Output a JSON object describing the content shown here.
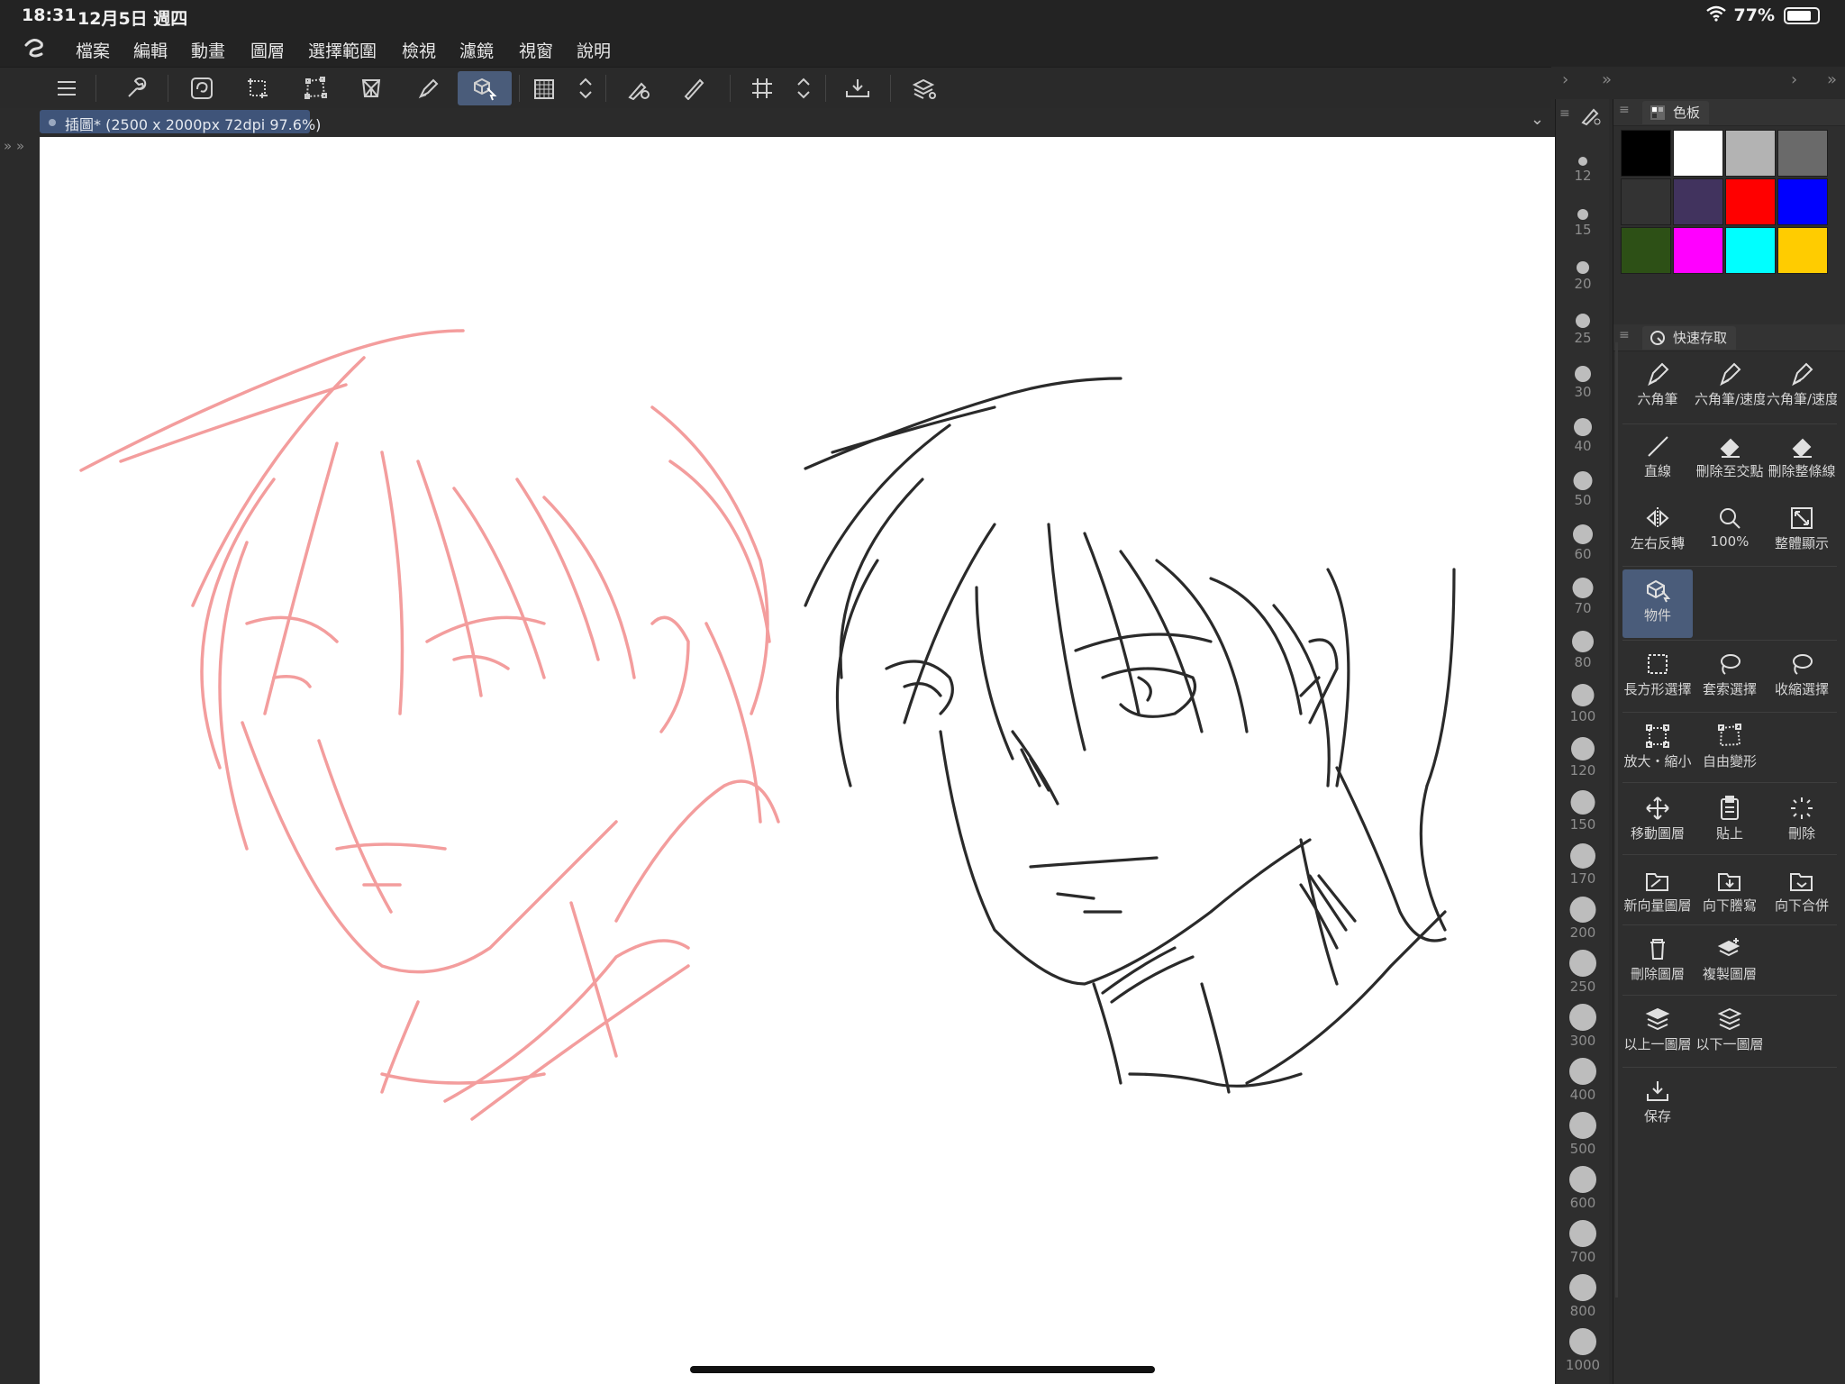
{
  "status_bar": {
    "time": "18:31",
    "date": "12月5日 週四",
    "battery_percent": "77%",
    "battery_level": 0.77,
    "wifi_icon": "wifi-icon"
  },
  "menu": [
    "檔案",
    "編輯",
    "動畫",
    "圖層",
    "選擇範圍",
    "檢視",
    "濾鏡",
    "視窗",
    "說明"
  ],
  "document": {
    "tab_label": "插圖* (2500 x 2000px 72dpi 97.6%)"
  },
  "brush_sizes": [
    "12",
    "15",
    "20",
    "25",
    "30",
    "40",
    "50",
    "60",
    "70",
    "80",
    "100",
    "120",
    "150",
    "170",
    "200",
    "250",
    "300",
    "400",
    "500",
    "600",
    "700",
    "800",
    "1000"
  ],
  "color_panel": {
    "title": "色板",
    "swatches": [
      "#000000",
      "#ffffff",
      "#b3b3b3",
      "#6a6a6a",
      "#333333",
      "#41335e",
      "#ff0000",
      "#0000ff",
      "#2d5016",
      "#ff00ff",
      "#00ffff",
      "#ffcc00"
    ]
  },
  "quick_access": {
    "title": "快速存取",
    "items": [
      {
        "label": "六角筆",
        "icon": "pen-nib-icon"
      },
      {
        "label": "六角筆/速度",
        "icon": "pen-nib-icon"
      },
      {
        "label": "六角筆/速度",
        "icon": "pen-nib-icon"
      },
      {
        "label": "直線",
        "icon": "line-icon"
      },
      {
        "label": "刪除至交點",
        "icon": "eraser-icon"
      },
      {
        "label": "刪除整條線",
        "icon": "eraser-icon"
      },
      {
        "label": "左右反轉",
        "icon": "flip-horizontal-icon"
      },
      {
        "label": "100%",
        "icon": "zoom-icon"
      },
      {
        "label": "整體顯示",
        "icon": "fit-screen-icon"
      },
      {
        "label": "物件",
        "icon": "object-select-icon"
      },
      {
        "label": "長方形選擇",
        "icon": "rect-select-icon"
      },
      {
        "label": "套索選擇",
        "icon": "lasso-icon"
      },
      {
        "label": "收縮選擇",
        "icon": "shrink-select-icon"
      },
      {
        "label": "放大・縮小",
        "icon": "scale-icon"
      },
      {
        "label": "自由變形",
        "icon": "free-transform-icon"
      },
      {
        "label": "移動圖層",
        "icon": "move-layer-icon"
      },
      {
        "label": "貼上",
        "icon": "paste-icon"
      },
      {
        "label": "刪除",
        "icon": "delete-selection-icon"
      },
      {
        "label": "新向量圖層",
        "icon": "new-vector-layer-icon"
      },
      {
        "label": "向下謄寫",
        "icon": "transfer-down-icon"
      },
      {
        "label": "向下合併",
        "icon": "merge-down-icon"
      },
      {
        "label": "刪除圖層",
        "icon": "trash-icon"
      },
      {
        "label": "複製圖層",
        "icon": "duplicate-layer-icon"
      },
      {
        "label": "以上一圖層",
        "icon": "layer-above-icon"
      },
      {
        "label": "以下一圖層",
        "icon": "layer-below-icon"
      },
      {
        "label": "保存",
        "icon": "save-icon"
      }
    ]
  }
}
